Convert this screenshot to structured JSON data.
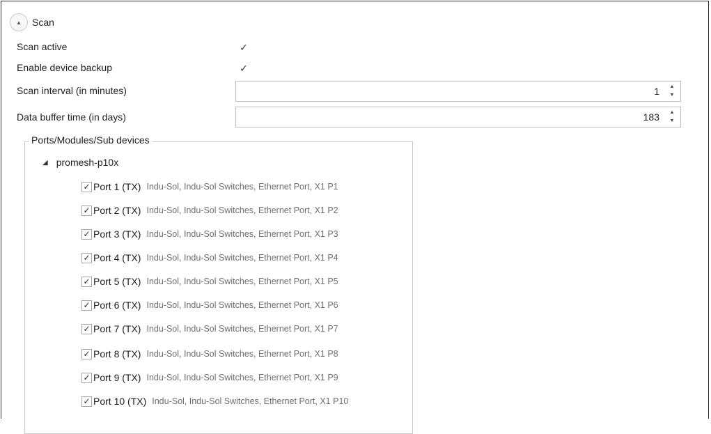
{
  "section": {
    "title": "Scan",
    "expander_icon": "▲"
  },
  "settings": {
    "scan_active": {
      "label": "Scan active",
      "checked": true,
      "mark": "✓"
    },
    "device_backup": {
      "label": "Enable device backup",
      "checked": true,
      "mark": "✓"
    },
    "scan_interval": {
      "label": "Scan interval (in minutes)",
      "value": "1"
    },
    "buffer_time": {
      "label": "Data buffer time (in days)",
      "value": "183"
    }
  },
  "spinner": {
    "up": "▲",
    "down": "▼"
  },
  "group": {
    "legend": "Ports/Modules/Sub devices",
    "device": {
      "name": "promesh-p10x",
      "expand_icon": "◢"
    },
    "ports": [
      {
        "name": "Port 1 (TX)",
        "desc": "Indu-Sol, Indu-Sol Switches, Ethernet Port, X1 P1",
        "mark": "✓"
      },
      {
        "name": "Port 2 (TX)",
        "desc": "Indu-Sol, Indu-Sol Switches, Ethernet Port, X1 P2",
        "mark": "✓"
      },
      {
        "name": "Port 3 (TX)",
        "desc": "Indu-Sol, Indu-Sol Switches, Ethernet Port, X1 P3",
        "mark": "✓"
      },
      {
        "name": "Port 4 (TX)",
        "desc": "Indu-Sol, Indu-Sol Switches, Ethernet Port, X1 P4",
        "mark": "✓"
      },
      {
        "name": "Port 5 (TX)",
        "desc": "Indu-Sol, Indu-Sol Switches, Ethernet Port, X1 P5",
        "mark": "✓"
      },
      {
        "name": "Port 6 (TX)",
        "desc": "Indu-Sol, Indu-Sol Switches, Ethernet Port, X1 P6",
        "mark": "✓"
      },
      {
        "name": "Port 7 (TX)",
        "desc": "Indu-Sol, Indu-Sol Switches, Ethernet Port, X1 P7",
        "mark": "✓"
      },
      {
        "name": "Port 8 (TX)",
        "desc": "Indu-Sol, Indu-Sol Switches, Ethernet Port, X1 P8",
        "mark": "✓"
      },
      {
        "name": "Port 9 (TX)",
        "desc": "Indu-Sol, Indu-Sol Switches, Ethernet Port, X1 P9",
        "mark": "✓"
      },
      {
        "name": "Port 10 (TX)",
        "desc": "Indu-Sol, Indu-Sol Switches, Ethernet Port, X1 P10",
        "mark": "✓"
      }
    ]
  }
}
